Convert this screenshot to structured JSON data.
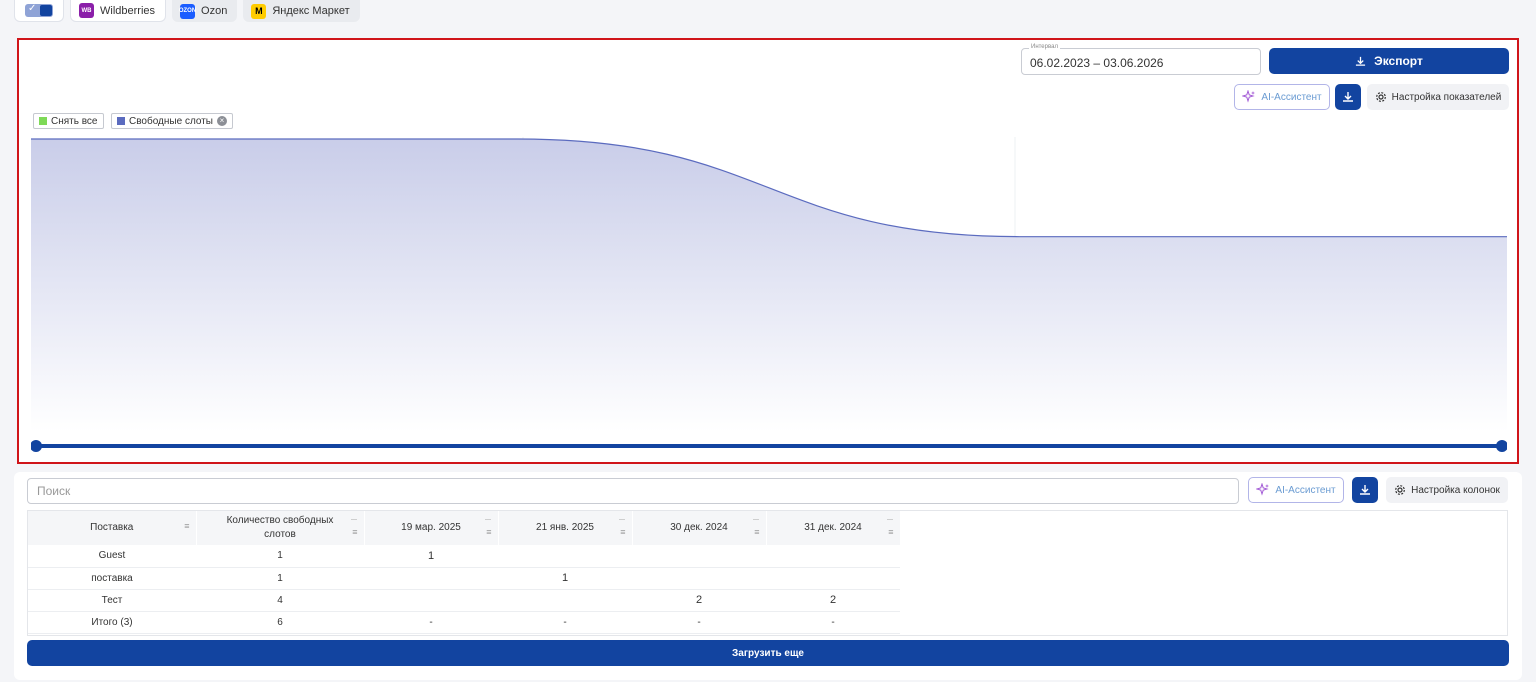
{
  "marketplaces": {
    "tabs": [
      {
        "label": "Wildberries",
        "logo": "WB"
      },
      {
        "label": "Ozon",
        "logo": "OZON"
      },
      {
        "label": "Яндекс Маркет",
        "logo": "M"
      }
    ]
  },
  "chart_panel": {
    "interval_label": "Интервал",
    "interval_value": "06.02.2023 – 03.06.2026",
    "export_label": "Экспорт",
    "ai_label": "AI-Ассистент",
    "settings_label": "Настройка показателей",
    "legend": {
      "clear_all": "Снять все",
      "series_name": "Свободные слоты"
    },
    "colors": {
      "series": "#5b6bbf",
      "clear": "#7ed957",
      "accent": "#1244a0",
      "highlight_border": "#d0151a"
    }
  },
  "chart_data": {
    "type": "area",
    "series": [
      {
        "name": "Свободные слоты",
        "values": [
          6,
          6,
          4,
          4
        ]
      }
    ],
    "x_relative": [
      0,
      0.33,
      0.67,
      1.0
    ],
    "grid": "vertical",
    "legend": "top-left",
    "tick_labels": []
  },
  "table_panel": {
    "search_placeholder": "Поиск",
    "ai_label": "AI-Ассистент",
    "settings_label": "Настройка колонок",
    "columns": [
      "Поставка",
      "Количество свободных слотов",
      "19 мар. 2025",
      "21 янв. 2025",
      "30 дек. 2024",
      "31 дек. 2024"
    ],
    "rows": [
      [
        "Guest",
        "1",
        "1",
        "",
        "",
        ""
      ],
      [
        "поставка",
        "1",
        "",
        "1",
        "",
        ""
      ],
      [
        "Тест",
        "4",
        "",
        "",
        "2",
        "2"
      ]
    ],
    "total": [
      "Итого (3)",
      "6",
      "-",
      "-",
      "-",
      "-"
    ],
    "load_more_label": "Загрузить еще"
  }
}
